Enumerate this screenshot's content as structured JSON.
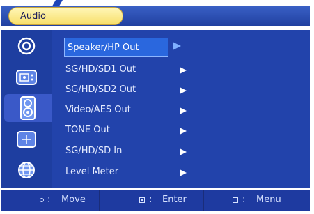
{
  "window": {
    "title": "Audio"
  },
  "sidebar": {
    "items": [
      {
        "icon": "target-icon",
        "active": false
      },
      {
        "icon": "video-display-icon",
        "active": false
      },
      {
        "icon": "speaker-icon",
        "active": true
      },
      {
        "icon": "crosshair-icon",
        "active": false
      },
      {
        "icon": "globe-icon",
        "active": false
      }
    ]
  },
  "menu": {
    "items": [
      {
        "label": "Speaker/HP Out",
        "selected": true
      },
      {
        "label": "SG/HD/SD1 Out"
      },
      {
        "label": "SG/HD/SD2 Out"
      },
      {
        "label": "Video/AES Out"
      },
      {
        "label": "TONE Out"
      },
      {
        "label": "SG/HD/SD In"
      },
      {
        "label": "Level Meter"
      }
    ]
  },
  "footer": {
    "move_label": "Move",
    "enter_label": "Enter",
    "menu_label": "Menu",
    "separator": ":"
  },
  "colors": {
    "panel": "#2243ab",
    "sidebar": "#1e3ea0",
    "selection": "#2a67de",
    "title_pill": "#f7df6a"
  }
}
